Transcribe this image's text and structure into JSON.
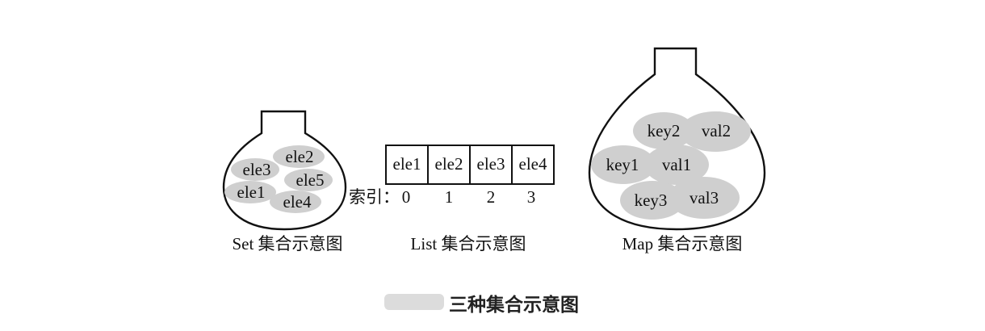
{
  "set": {
    "elements": [
      "ele2",
      "ele3",
      "ele5",
      "ele1",
      "ele4"
    ],
    "caption": "Set 集合示意图"
  },
  "list": {
    "elements": [
      "ele1",
      "ele2",
      "ele3",
      "ele4"
    ],
    "index_label": "索引：",
    "indices": [
      "0",
      "1",
      "2",
      "3"
    ],
    "caption": "List 集合示意图"
  },
  "map": {
    "pairs": [
      {
        "key": "key2",
        "val": "val2"
      },
      {
        "key": "key1",
        "val": "val1"
      },
      {
        "key": "key3",
        "val": "val3"
      }
    ],
    "caption": "Map 集合示意图"
  },
  "figure_caption": "三种集合示意图",
  "colors": {
    "blob": "#cfcfcf",
    "stroke": "#111111"
  }
}
